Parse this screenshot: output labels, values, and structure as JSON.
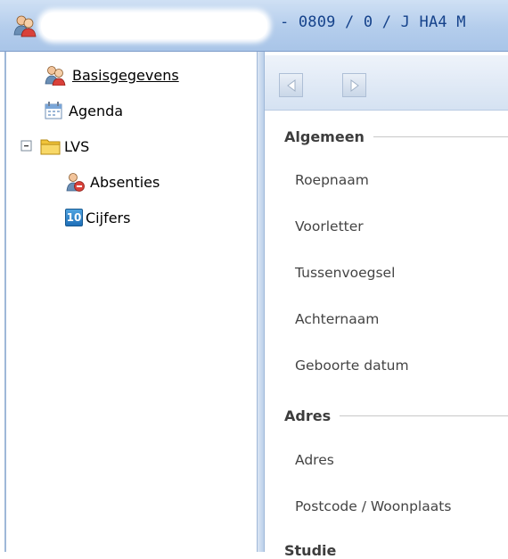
{
  "window": {
    "title": "- 0809 / 0 / J HA4 M",
    "avatar_icon": "students-icon"
  },
  "sidebar": {
    "items": [
      {
        "label": "Basisgegevens",
        "icon": "students-icon",
        "selected": true
      },
      {
        "label": "Agenda",
        "icon": "calendar-icon"
      },
      {
        "label": "LVS",
        "icon": "folder-icon",
        "expander": "collapse-icon"
      },
      {
        "label": "Absenties",
        "icon": "absence-icon"
      },
      {
        "label": "Cijfers",
        "icon": "grades-icon",
        "icon_text": "10"
      }
    ]
  },
  "toolbar": {
    "back_icon": "arrow-left-icon",
    "forward_icon": "arrow-right-icon"
  },
  "content": {
    "sections": [
      {
        "title": "Algemeen",
        "fields": [
          "Roepnaam",
          "Voorletter",
          "Tussenvoegsel",
          "Achternaam",
          "Geboorte datum"
        ]
      },
      {
        "title": "Adres",
        "fields": [
          "Adres",
          "Postcode / Woonplaats"
        ]
      }
    ],
    "partial_section": "Studie"
  },
  "colors": {
    "title_text": "#15428b",
    "titlebar": "#b4cdec",
    "pane_border": "#9fb8d8"
  }
}
